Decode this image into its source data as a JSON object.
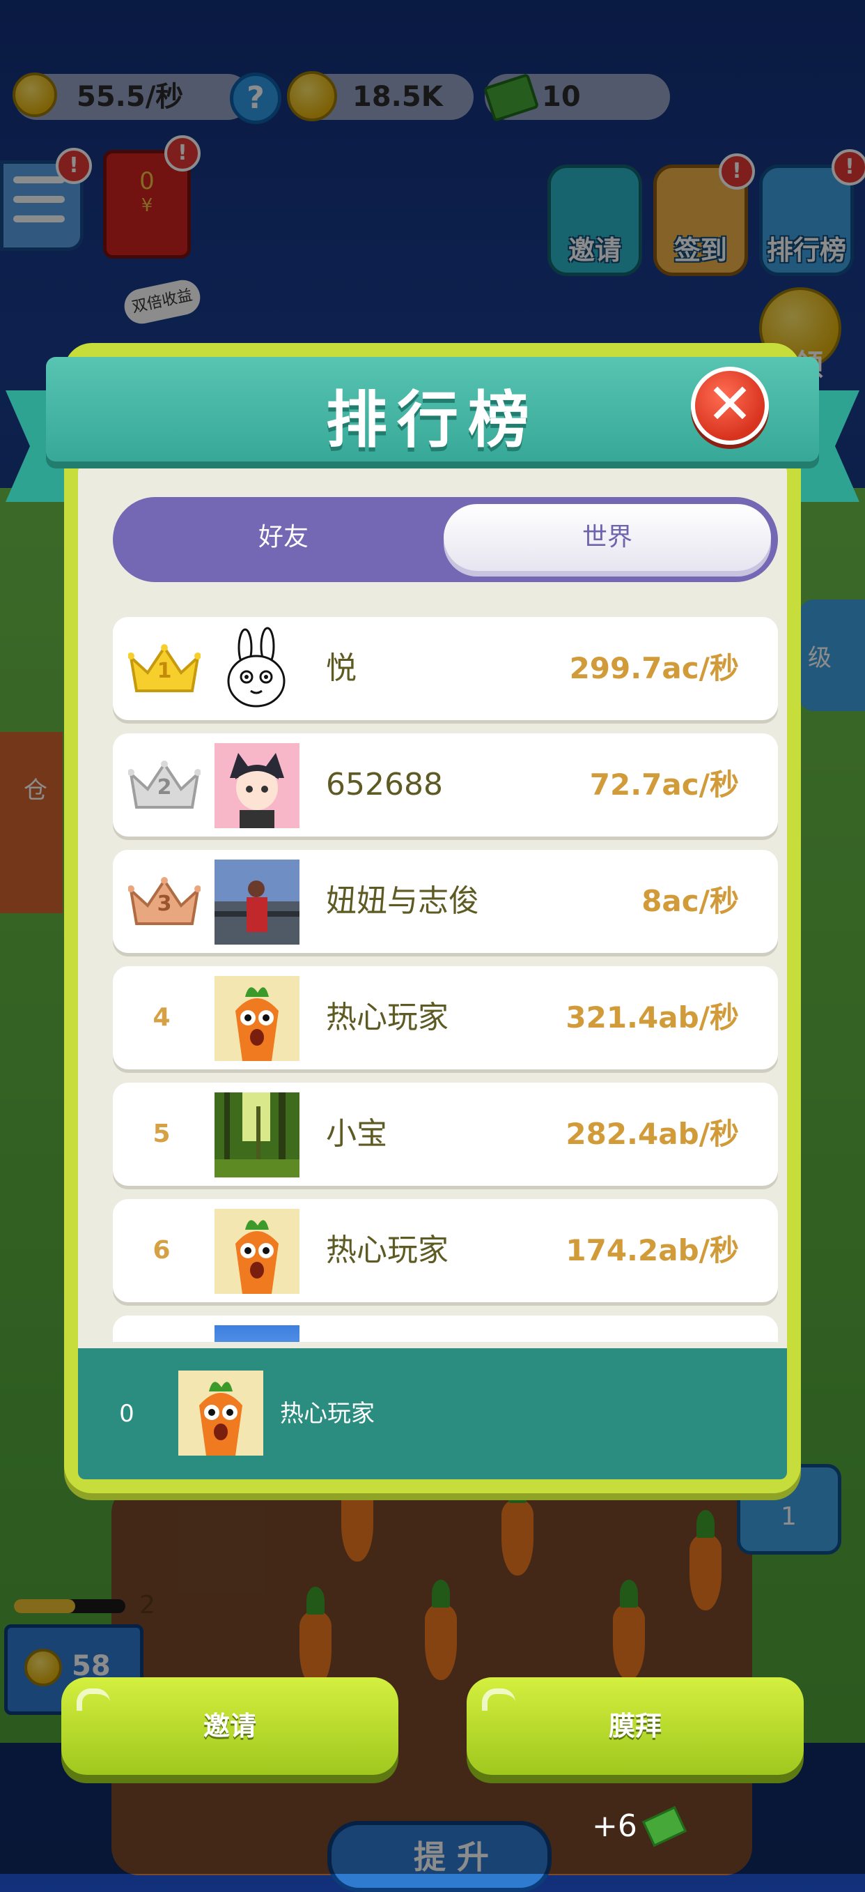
{
  "hud": {
    "rate": "55.5/秒",
    "coins": "18.5K",
    "cash": "10"
  },
  "top_left": {
    "menu_badge": "!",
    "red_packet_value": "0",
    "red_packet_symbol": "¥",
    "red_packet_badge": "!"
  },
  "side_buttons": [
    {
      "label": "邀请"
    },
    {
      "label": "签到",
      "badge": "!"
    },
    {
      "label": "排行榜",
      "badge": "!"
    }
  ],
  "background_labels": {
    "double_income": "双倍收益",
    "claim": "领",
    "warehouse": "仓",
    "level_tag": "级",
    "plot_level": "1",
    "field_level": "2",
    "bottom_coin_count": "58",
    "upgrade": "提 升",
    "reward": "+6"
  },
  "modal": {
    "title": "排行榜",
    "close": "✕",
    "tabs": {
      "friends": "好友",
      "world": "世界",
      "active": "world"
    },
    "rows": [
      {
        "rank": "1",
        "name": "悦",
        "score": "299.7ac/秒",
        "avatar": "white-rabbit",
        "crown": "gold"
      },
      {
        "rank": "2",
        "name": "652688",
        "score": "72.7ac/秒",
        "avatar": "cat-boy",
        "crown": "silver"
      },
      {
        "rank": "3",
        "name": "妞妞与志俊",
        "score": "8ac/秒",
        "avatar": "photo-people",
        "crown": "bronze"
      },
      {
        "rank": "4",
        "name": "热心玩家",
        "score": "321.4ab/秒",
        "avatar": "carrot"
      },
      {
        "rank": "5",
        "name": "小宝",
        "score": "282.4ab/秒",
        "avatar": "forest"
      },
      {
        "rank": "6",
        "name": "热心玩家",
        "score": "174.2ab/秒",
        "avatar": "carrot"
      }
    ],
    "me": {
      "rank": "0",
      "name": "热心玩家",
      "avatar": "carrot"
    }
  },
  "buttons": {
    "invite": "邀请",
    "worship": "膜拜"
  },
  "colors": {
    "modal_frame": "#c6dd3b",
    "header": "#37a898",
    "tab_track": "#7467b3",
    "score": "#d29b3a",
    "my_bar": "#2b8c80",
    "button": "#a9d022"
  }
}
